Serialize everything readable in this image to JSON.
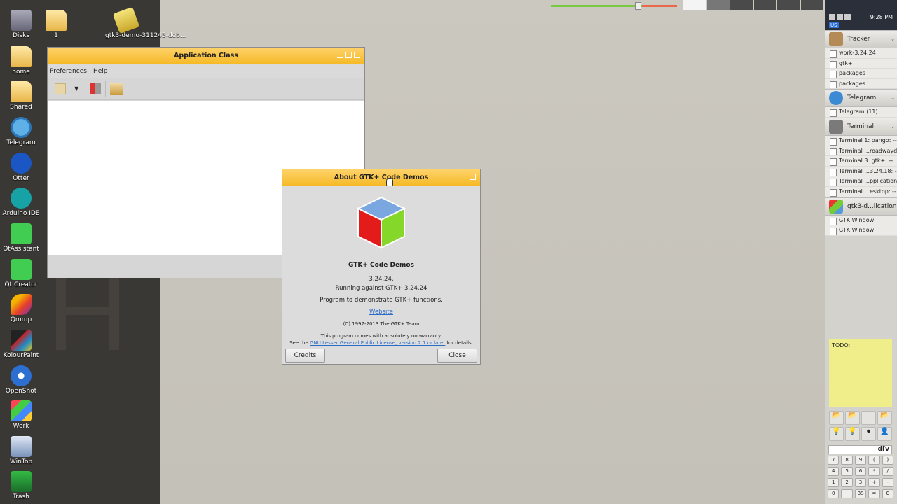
{
  "desktop": {
    "icons": [
      {
        "label": "Disks"
      },
      {
        "label": "1"
      },
      {
        "label": "gtk3-demo-311245-deb..."
      },
      {
        "label": "home"
      },
      {
        "label": "Shared"
      },
      {
        "label": "Telegram"
      },
      {
        "label": "Otter"
      },
      {
        "label": "Arduino IDE"
      },
      {
        "label": "QtAssistant"
      },
      {
        "label": "Qt Creator"
      },
      {
        "label": "Qmmp"
      },
      {
        "label": "KolourPaint"
      },
      {
        "label": "OpenShot"
      },
      {
        "label": "Work"
      },
      {
        "label": "WinTop"
      },
      {
        "label": "Trash"
      }
    ]
  },
  "app_window": {
    "title": "Application Class",
    "menu": [
      "Preferences",
      "Help"
    ]
  },
  "about_dialog": {
    "title": "About GTK+ Code Demos",
    "program_name": "GTK+ Code Demos",
    "version": "3.24.24,",
    "running": "Running against GTK+ 3.24.24",
    "comment": "Program to demonstrate GTK+ functions.",
    "website": "Website",
    "copyright": "(C) 1997-2013 The GTK+ Team",
    "license_line1": "This program comes with absolutely no warranty.",
    "license_prefix": "See the",
    "license_link": "GNU Lesser General Public License, version 2.1 or later",
    "license_suffix": "for details.",
    "credits_button": "Credits",
    "close_button": "Close"
  },
  "panel": {
    "clock": "9:28 PM",
    "keyboard": "US",
    "groups": [
      {
        "name": "Tracker",
        "items": [
          "work-3.24.24",
          "gtk+",
          "packages",
          "packages"
        ]
      },
      {
        "name": "Telegram",
        "items": [
          "Telegram (11)"
        ]
      },
      {
        "name": "Terminal",
        "items": [
          "Terminal 1: pango: --",
          "Terminal ...roadwayd",
          "Terminal 3: gtk+: --",
          "Terminal ...3.24.18: --",
          "Terminal ...pplication",
          "Terminal ...esktop: --"
        ]
      },
      {
        "name": "gtk3-d...lication",
        "items": [
          "GTK Window",
          "GTK Window"
        ]
      }
    ],
    "todo": "TODO:",
    "calc_display": "d[v",
    "calc_keys": [
      "7",
      "8",
      "9",
      "(",
      ")",
      "4",
      "5",
      "6",
      "*",
      "/",
      "1",
      "2",
      "3",
      "+",
      "-",
      "0",
      ".",
      "BS",
      "=",
      "C"
    ]
  },
  "colors": {
    "titlebar": "#f5b925",
    "link": "#2a6cc8",
    "todo": "#f0ee8a"
  }
}
